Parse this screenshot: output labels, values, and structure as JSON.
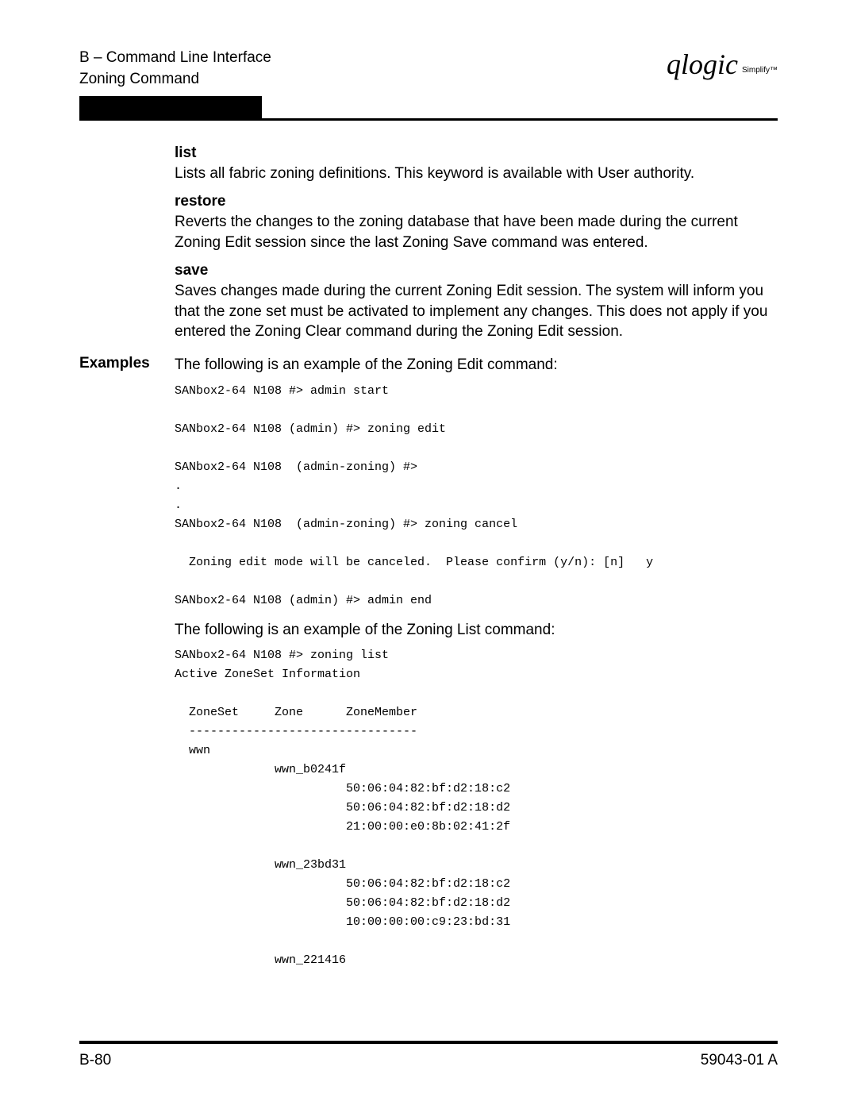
{
  "header": {
    "line1": "B – Command Line Interface",
    "line2": "Zoning Command",
    "logo_main": "qlogic",
    "logo_sub": "Simplify™"
  },
  "keywords": {
    "list": {
      "title": "list",
      "desc": "Lists all fabric zoning definitions. This keyword is available with User authority."
    },
    "restore": {
      "title": "restore",
      "desc": "Reverts the changes to the zoning database that have been made during the current Zoning Edit session since the last Zoning Save command was entered."
    },
    "save": {
      "title": "save",
      "desc": "Saves changes made during the current Zoning Edit session. The system will inform you that the zone set must be activated to implement any changes. This does not apply if you entered the Zoning Clear command during the Zoning Edit session."
    }
  },
  "examples": {
    "label": "Examples",
    "intro1": "The following is an example of the Zoning Edit command:",
    "code1": "SANbox2-64 N108 #> admin start\n\nSANbox2-64 N108 (admin) #> zoning edit\n\nSANbox2-64 N108  (admin-zoning) #>\n.\n.\nSANbox2-64 N108  (admin-zoning) #> zoning cancel\n\n  Zoning edit mode will be canceled.  Please confirm (y/n): [n]   y\n\nSANbox2-64 N108 (admin) #> admin end",
    "intro2": "The following is an example of the Zoning List command:",
    "code2": "SANbox2-64 N108 #> zoning list\nActive ZoneSet Information\n\n  ZoneSet     Zone      ZoneMember\n  --------------------------------\n  wwn\n              wwn_b0241f\n                        50:06:04:82:bf:d2:18:c2\n                        50:06:04:82:bf:d2:18:d2\n                        21:00:00:e0:8b:02:41:2f\n\n              wwn_23bd31\n                        50:06:04:82:bf:d2:18:c2\n                        50:06:04:82:bf:d2:18:d2\n                        10:00:00:00:c9:23:bd:31\n\n              wwn_221416"
  },
  "footer": {
    "left": "B-80",
    "right": "59043-01  A"
  }
}
